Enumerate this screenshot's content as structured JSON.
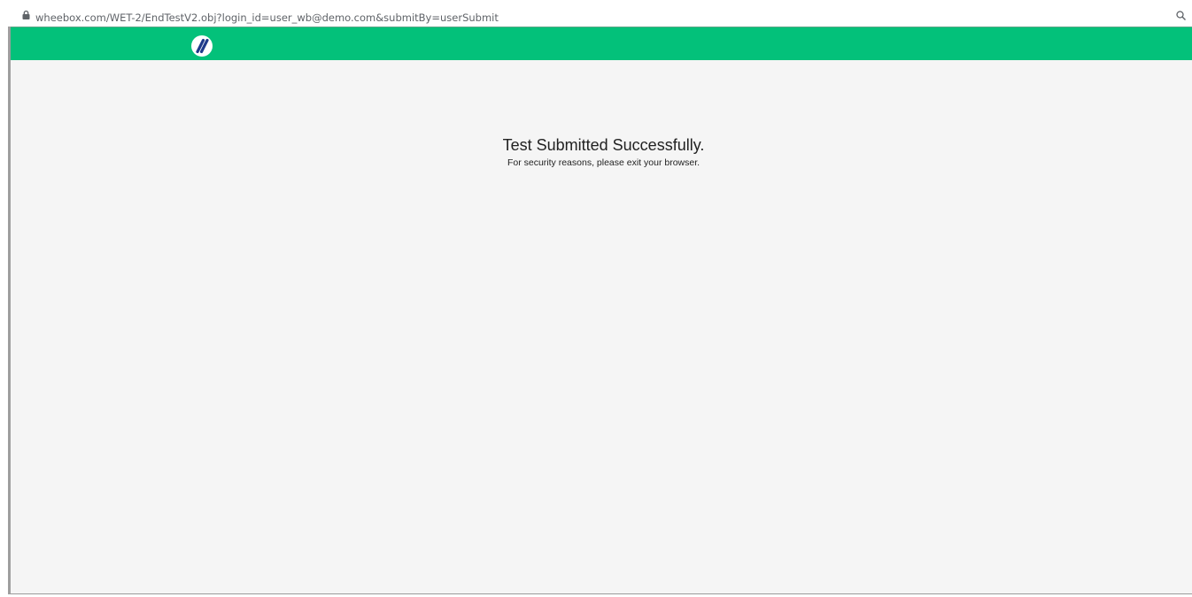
{
  "browser": {
    "url": "wheebox.com/WET-2/EndTestV2.obj?login_id=user_wb@demo.com&submitBy=userSubmit"
  },
  "icons": {
    "lock": "lock-icon",
    "zoom": "magnifier-icon",
    "logo": "wheebox-logo"
  },
  "header": {
    "color": "#03c17a"
  },
  "message": {
    "title": "Test Submitted Successfully.",
    "subtitle": "For security reasons, please exit your browser."
  }
}
